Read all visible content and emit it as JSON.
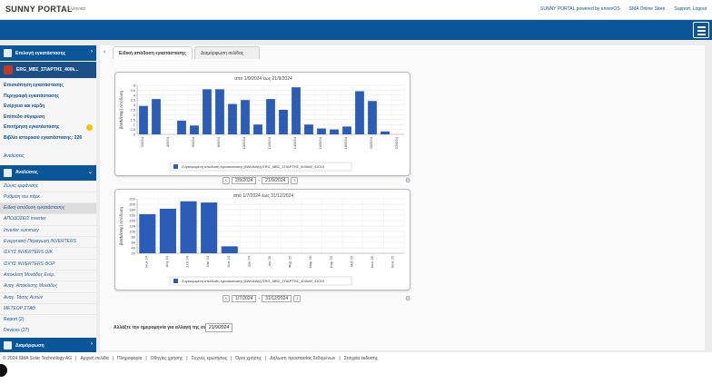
{
  "header": {
    "logo": "SUNNY PORTAL",
    "language": "Ελληνικά",
    "links": [
      "SUNNY PORTAL powered by ennexOS",
      "SMA Online Store",
      "Support, Logout"
    ],
    "menu_icon": "hamburger-icon"
  },
  "sidebar": {
    "select_plant": "Επιλογή εγκατάστασης",
    "plant_name": "ERG_ΜΒΣ_ΣΠΑΡΤΗΣ_400k...",
    "items": [
      "Επισκόπηση εγκατάστασης",
      "Περιγραφή εγκατάστασης",
      "Ενέργεια και κέρδη",
      "Επίπεδο σύγκριση",
      "Επιτήρηση εγκατάστασης",
      "Βιβλίο ιστορικού εγκατάστασης: 226",
      "Αναλύσεις"
    ],
    "analysis_header": "Αναλύσεις",
    "analysis_items": [
      "Ζώνες εμφάνισης",
      "Ρύθμιση του πάρκ",
      "Ειδική απόδοση εγκατάστασης",
      "ΑΠΟΔΟΣΕΙΣ inverter",
      "Inverter summary",
      "Ενεργειακή Παραγωγή INVERTERS",
      "ΙΣΧΥΣ INVERTERS ΟΙΚ",
      "ΙΣΧΥΣ INVERTERS ΘΟΡ",
      "Απόκλιση Μονάδος Ενέρ.",
      "Αναγ. Απόκλισης Μονάδος",
      "Αναγ. Τάσης Αυτών",
      "ΜΕΤΕΩΡ ΣΤΑΘ"
    ],
    "report": "Report (2)",
    "devices": "Devices (27)",
    "config_header": "Διαμόρφωση"
  },
  "tabs": [
    "Ειδική απόδοση εγκατάστασης",
    "Διαμόρφωση σελίδας"
  ],
  "chart_nav": {
    "top": {
      "from": "2/9/2024",
      "to": "21/9/2024"
    },
    "bottom": {
      "from": "1/7/2024",
      "to": "31/12/2024"
    }
  },
  "status": {
    "label": "Αλλάξτε την ημερομηνία για αλλαγή της σελίδας:",
    "date": "21/9/2024"
  },
  "footer": {
    "copyright": "© 2024 SMA Solar Technology AG",
    "links": [
      "Αρχική σελίδα",
      "Πληροφορία",
      "Οδηγίες χρήσης",
      "Συχνές ερωτήσεις",
      "Όροι χρήσης",
      "Δήλωση προστασίας δεδομένων",
      "Στοιχεία έκδοσης"
    ]
  },
  "chart_data": [
    {
      "type": "bar",
      "title": "από 1/9/2024 έως 21/9/2024",
      "ylabel": "[kWh/kWp] Απόδοση",
      "ylim": [
        0,
        5
      ],
      "yticks": [
        "5",
        "4.5",
        "4",
        "3.5",
        "3",
        "2.5",
        "2",
        "1.5",
        "1",
        "0.5",
        "0"
      ],
      "categories": [
        "2/9/24",
        "4/9/24",
        "6/9/24",
        "8/9/24",
        "10/9/24",
        "12/9/24",
        "14/9/24",
        "16/9/24",
        "18/9/24",
        "20/9/24",
        "22/9/24",
        "24/9/24",
        "26/9/24",
        "28/9/24",
        "30/9/24"
      ],
      "values": [
        2.9,
        3.6,
        0,
        1.4,
        0.9,
        4.6,
        4.6,
        3.1,
        3.5,
        1.0,
        3.6,
        2.5,
        4.8,
        1.0,
        0.6,
        0.5,
        0.8,
        4.4,
        3.4,
        0.3,
        0
      ],
      "legend": "Συγκεκριμένη απόδοση εγκατάστασης [kWh/kWp] ERG_ΜΒΣ_ΣΠΑΡΤΗΣ_400kW_41010",
      "series_color": "#2a5cb8"
    },
    {
      "type": "bar",
      "title": "από 1/7/2024 έως 31/12/2024",
      "ylabel": "[kWh/kWp] Απόδοση",
      "ylim": [
        0,
        220
      ],
      "yticks": [
        "220",
        "200",
        "180",
        "160",
        "140",
        "120",
        "100",
        "80",
        "60",
        "40",
        "20"
      ],
      "categories": [
        "Ιουλ 24",
        "Αυγ 24",
        "Σεπ 24",
        "Οκτ 24",
        "Νοε 24",
        "Δεκ 24",
        "Ιαν 25",
        "Φεβ 25",
        "Μαρ 25",
        "Απρ 25",
        "Μαϊ 25",
        "Ιουν 25",
        "Ιουλ 25"
      ],
      "values": [
        158,
        180,
        210,
        205,
        28,
        0,
        0,
        0,
        0,
        0,
        0,
        0,
        0
      ],
      "legend": "Συγκεκριμένη απόδοση εγκατάστασης [kWh/kWp] ERG_ΜΒΣ_ΣΠΑΡΤΗΣ_400kW_41010",
      "series_color": "#2a5cb8"
    }
  ]
}
